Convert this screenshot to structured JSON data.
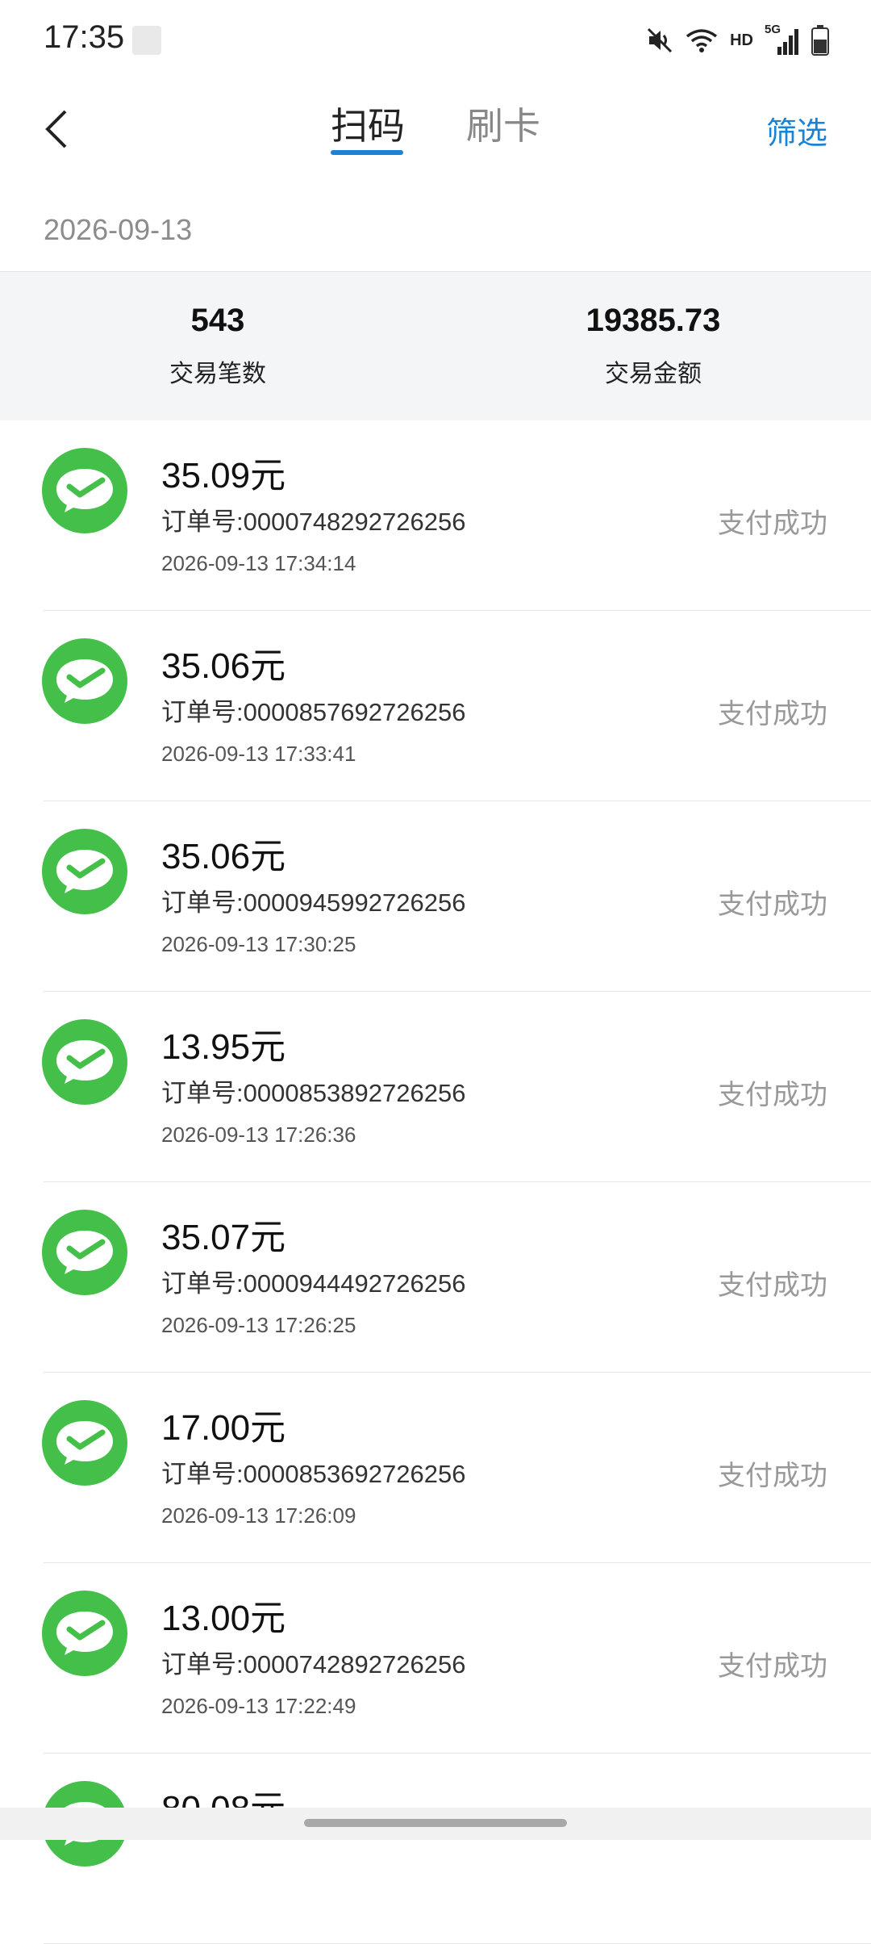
{
  "status_bar": {
    "time": "17:35",
    "hd_label": "HD",
    "network_label": "5G",
    "icons": [
      "mute-icon",
      "wifi-icon",
      "cellular-signal-icon",
      "battery-icon"
    ]
  },
  "header": {
    "tabs": [
      {
        "label": "扫码",
        "active": true
      },
      {
        "label": "刷卡",
        "active": false
      }
    ],
    "filter_label": "筛选",
    "accent_color": "#1a83d5"
  },
  "date": "2026-09-13",
  "summary": {
    "count_value": "543",
    "count_label": "交易笔数",
    "amount_value": "19385.73",
    "amount_label": "交易金额"
  },
  "transactions": [
    {
      "amount": "35.09元",
      "order": "订单号:0000748292726256",
      "time": "2026-09-13 17:34:14",
      "status": "支付成功"
    },
    {
      "amount": "35.06元",
      "order": "订单号:0000857692726256",
      "time": "2026-09-13 17:33:41",
      "status": "支付成功"
    },
    {
      "amount": "35.06元",
      "order": "订单号:0000945992726256",
      "time": "2026-09-13 17:30:25",
      "status": "支付成功"
    },
    {
      "amount": "13.95元",
      "order": "订单号:0000853892726256",
      "time": "2026-09-13 17:26:36",
      "status": "支付成功"
    },
    {
      "amount": "35.07元",
      "order": "订单号:0000944492726256",
      "time": "2026-09-13 17:26:25",
      "status": "支付成功"
    },
    {
      "amount": "17.00元",
      "order": "订单号:0000853692726256",
      "time": "2026-09-13 17:26:09",
      "status": "支付成功"
    },
    {
      "amount": "13.00元",
      "order": "订单号:0000742892726256",
      "time": "2026-09-13 17:22:49",
      "status": "支付成功"
    },
    {
      "amount": "80.08元",
      "order": "",
      "time": "",
      "status": ""
    }
  ],
  "wechat_icon_color": "#44c04a"
}
